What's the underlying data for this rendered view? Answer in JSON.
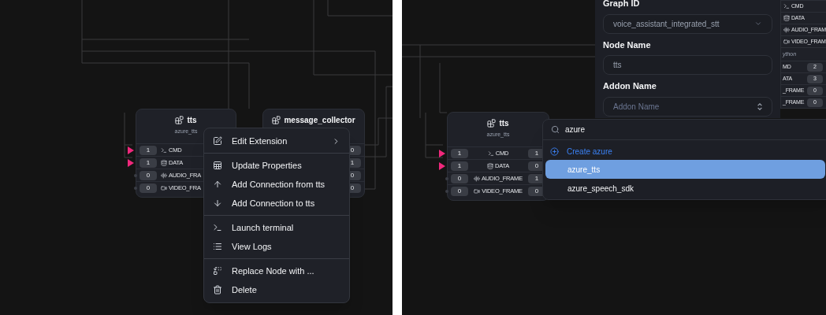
{
  "left_canvas": {
    "nodes": [
      {
        "title": "tts",
        "subtitle": "azure_tts",
        "ports": [
          {
            "kind": "cmd",
            "label": "CMD",
            "in": "1",
            "connected": true
          },
          {
            "kind": "data",
            "label": "DATA",
            "in": "1",
            "connected": true
          },
          {
            "kind": "audio",
            "label": "AUDIO_FRA",
            "in": "0",
            "connected": false
          },
          {
            "kind": "video",
            "label": "VIDEO_FRA",
            "in": "0",
            "connected": false
          }
        ]
      },
      {
        "title": "message_collector",
        "ports": [
          {
            "out": "0"
          },
          {
            "out": "1"
          },
          {
            "out": "0"
          },
          {
            "out": "0"
          }
        ]
      }
    ],
    "context_menu": {
      "groups": [
        [
          {
            "kind": "edit",
            "label": "Edit Extension",
            "submenu": true
          }
        ],
        [
          {
            "kind": "properties",
            "label": "Update Properties",
            "submenu": false
          },
          {
            "kind": "from",
            "label": "Add Connection from tts",
            "submenu": false
          },
          {
            "kind": "to",
            "label": "Add Connection to tts",
            "submenu": false
          }
        ],
        [
          {
            "kind": "terminal",
            "label": "Launch terminal",
            "submenu": false
          },
          {
            "kind": "logs",
            "label": "View Logs",
            "submenu": false
          }
        ],
        [
          {
            "kind": "replace",
            "label": "Replace Node with ...",
            "submenu": false
          },
          {
            "kind": "delete",
            "label": "Delete",
            "submenu": false
          }
        ]
      ]
    }
  },
  "right_canvas": {
    "nodes": [
      {
        "title": "tts",
        "subtitle": "azure_tts",
        "ports": [
          {
            "kind": "cmd",
            "label": "CMD",
            "in": "1",
            "out": "1",
            "connected": true
          },
          {
            "kind": "data",
            "label": "DATA",
            "in": "1",
            "out": "0",
            "connected": true
          },
          {
            "kind": "audio",
            "label": "AUDIO_FRAME",
            "in": "0",
            "out": "1",
            "connected": false
          },
          {
            "kind": "video",
            "label": "VIDEO_FRAME",
            "in": "0",
            "out": "0",
            "connected": false
          }
        ]
      }
    ],
    "background_nodes": [
      {
        "ports": [
          {
            "kind": "cmd",
            "label": "CMD"
          },
          {
            "kind": "data",
            "label": "DATA"
          },
          {
            "kind": "audio",
            "label": "AUDIO_FRAM"
          },
          {
            "kind": "video",
            "label": "VIDEO_FRAM"
          }
        ]
      },
      {
        "subtitle": "ython",
        "ports": [
          {
            "label": "MD",
            "out": "2"
          },
          {
            "label": "ATA",
            "out": "3"
          },
          {
            "label": "_FRAME",
            "out": "0"
          },
          {
            "label": "_FRAME",
            "out": "0"
          }
        ]
      }
    ],
    "form": {
      "fields": [
        {
          "kind": "select",
          "label": "Graph ID",
          "value": "voice_assistant_integrated_stt"
        },
        {
          "kind": "input",
          "label": "Node Name",
          "value": "tts"
        },
        {
          "kind": "combobox",
          "label": "Addon Name",
          "placeholder": "Addon Name"
        }
      ]
    },
    "addon_dropdown": {
      "query": "azure",
      "create_label": "Create azure",
      "options": [
        {
          "label": "azure_tts",
          "selected": true
        },
        {
          "label": "azure_speech_sdk",
          "selected": false
        }
      ]
    }
  }
}
